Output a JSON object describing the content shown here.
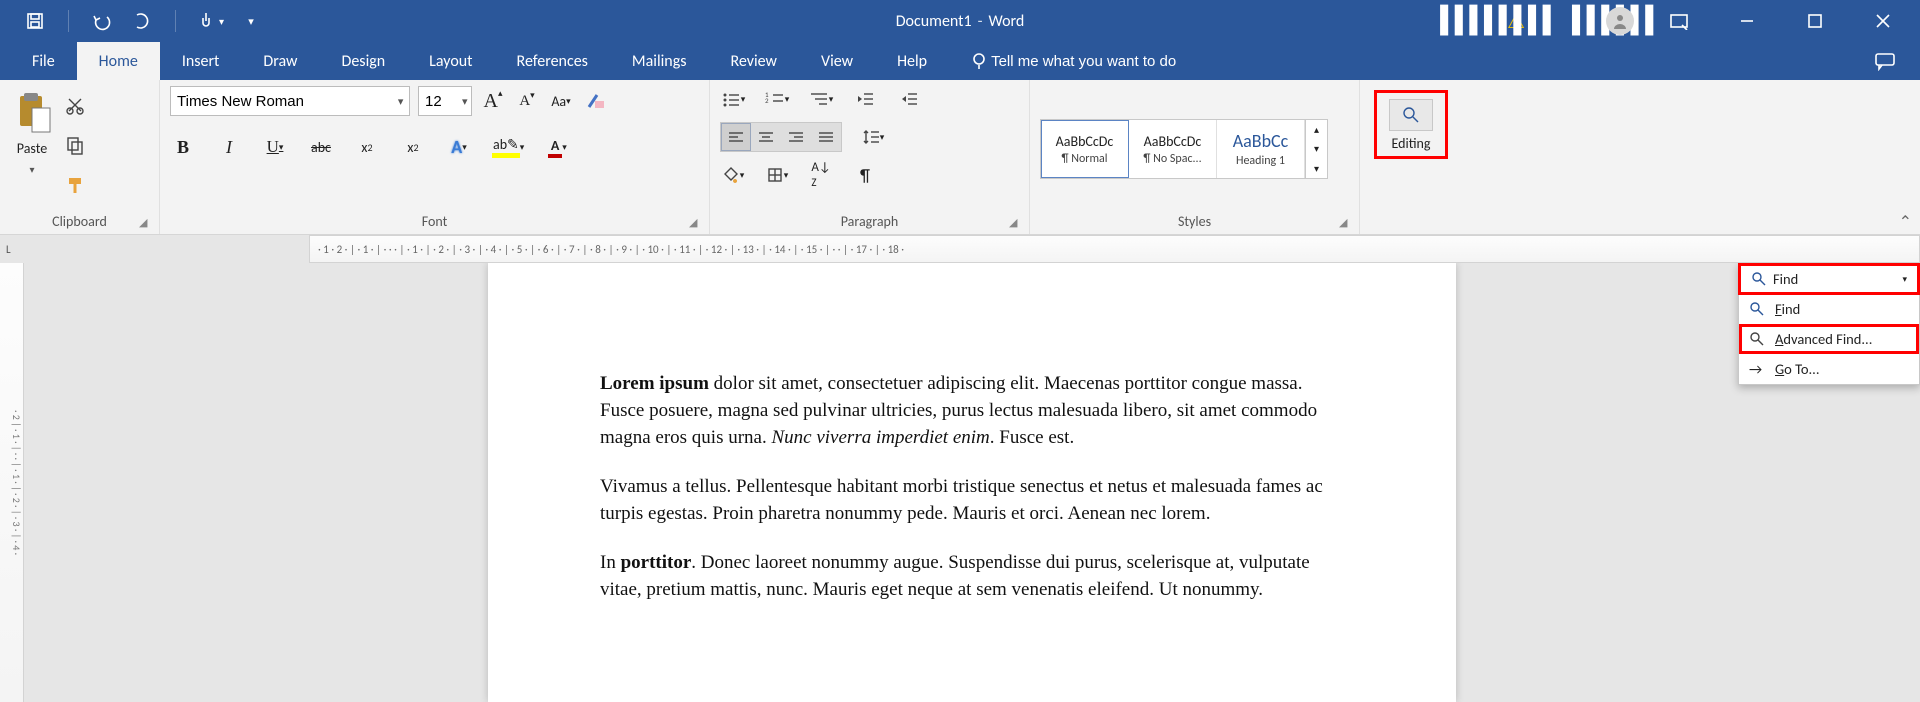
{
  "title": {
    "doc": "Document1",
    "app": "Word"
  },
  "qat": {
    "save": "save-icon",
    "undo": "undo-icon",
    "redo": "redo-icon",
    "touch": "touch-mode-icon",
    "customize": "customize-qat-icon"
  },
  "tabs": [
    "File",
    "Home",
    "Insert",
    "Draw",
    "Design",
    "Layout",
    "References",
    "Mailings",
    "Review",
    "View",
    "Help"
  ],
  "active_tab": "Home",
  "tell_me_placeholder": "Tell me what you want to do",
  "ribbon": {
    "clipboard": {
      "label": "Clipboard",
      "paste": "Paste"
    },
    "font": {
      "label": "Font",
      "name": "Times New Roman",
      "size": "12",
      "bold": "B",
      "italic": "I",
      "underline": "U",
      "strike": "abc",
      "sub": "x",
      "sup": "x",
      "aa": "Aa",
      "bigA": "A",
      "smallA": "A"
    },
    "paragraph": {
      "label": "Paragraph"
    },
    "styles": {
      "label": "Styles",
      "tiles": [
        {
          "sample": "AaBbCcDc",
          "label": "¶ Normal",
          "accent": "#222"
        },
        {
          "sample": "AaBbCcDc",
          "label": "¶ No Spac...",
          "accent": "#222"
        },
        {
          "sample": "AaBbCc",
          "label": "Heading 1",
          "accent": "#2b579a"
        }
      ]
    },
    "editing": {
      "label": "Editing",
      "find_label": "Find",
      "find_menu": {
        "find": "Find",
        "advanced": "Advanced Find...",
        "goto": "Go To..."
      }
    }
  },
  "document": {
    "p1": {
      "lead": "Lorem ipsum",
      "rest_a": " dolor sit amet, consectetuer adipiscing elit. Maecenas porttitor congue massa. Fusce posuere, magna sed pulvinar ultricies, purus lectus malesuada libero, sit amet commodo magna eros quis urna. ",
      "ital": "Nunc viverra imperdiet enim",
      "rest_b": ". Fusce est."
    },
    "p2": "Vivamus a tellus. Pellentesque habitant morbi tristique senectus et netus et malesuada fames ac turpis egestas. Proin pharetra nonummy pede. Mauris et orci. Aenean nec lorem.",
    "p3": {
      "a": "In ",
      "b": "porttitor",
      "c": ". Donec laoreet nonummy augue. Suspendisse dui purus, scelerisque at, vulputate vitae, pretium mattis, nunc. Mauris eget neque at sem venenatis eleifend. Ut nonummy."
    }
  },
  "ruler_text": "· 1 · 2 · | · 1 · | · · · | · 1 · | · 2 · | · 3 · | · 4 · | · 5 · | · 6 · | · 7 · | · 8 · | · 9 · | · 10 · | · 11 · | · 12 · | · 13 · | · 14 · | · 15 · | · · | · 17 · | · 18 ·",
  "vruler_text": "· 2 | · 1 · | · · | · 1 · | · 2 · | · 3 · | · 4 ·"
}
